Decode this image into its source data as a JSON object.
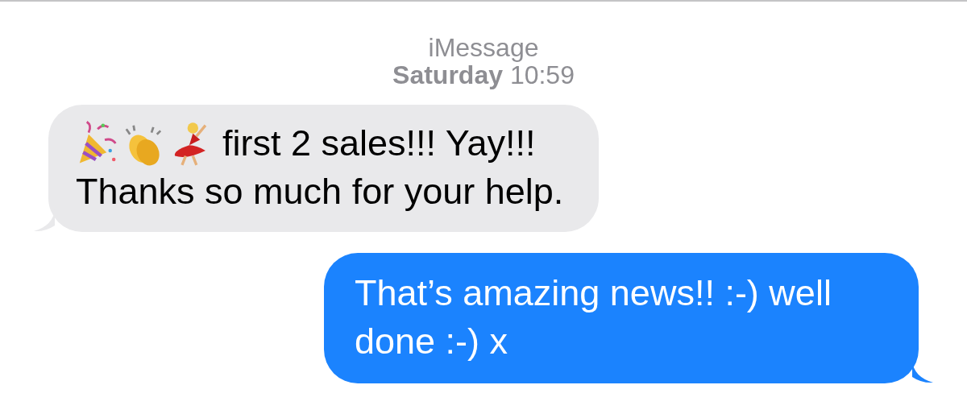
{
  "header": {
    "service": "iMessage",
    "day": "Saturday",
    "time": "10:59"
  },
  "messages": [
    {
      "kind": "incoming",
      "emoji_prefix": true,
      "lines": [
        "first 2 sales!!! Yay!!!",
        "Thanks so much for your help."
      ]
    },
    {
      "kind": "outgoing",
      "emoji_prefix": false,
      "lines": [
        "That’s amazing news!! :-) well",
        "done :-) x"
      ]
    }
  ]
}
